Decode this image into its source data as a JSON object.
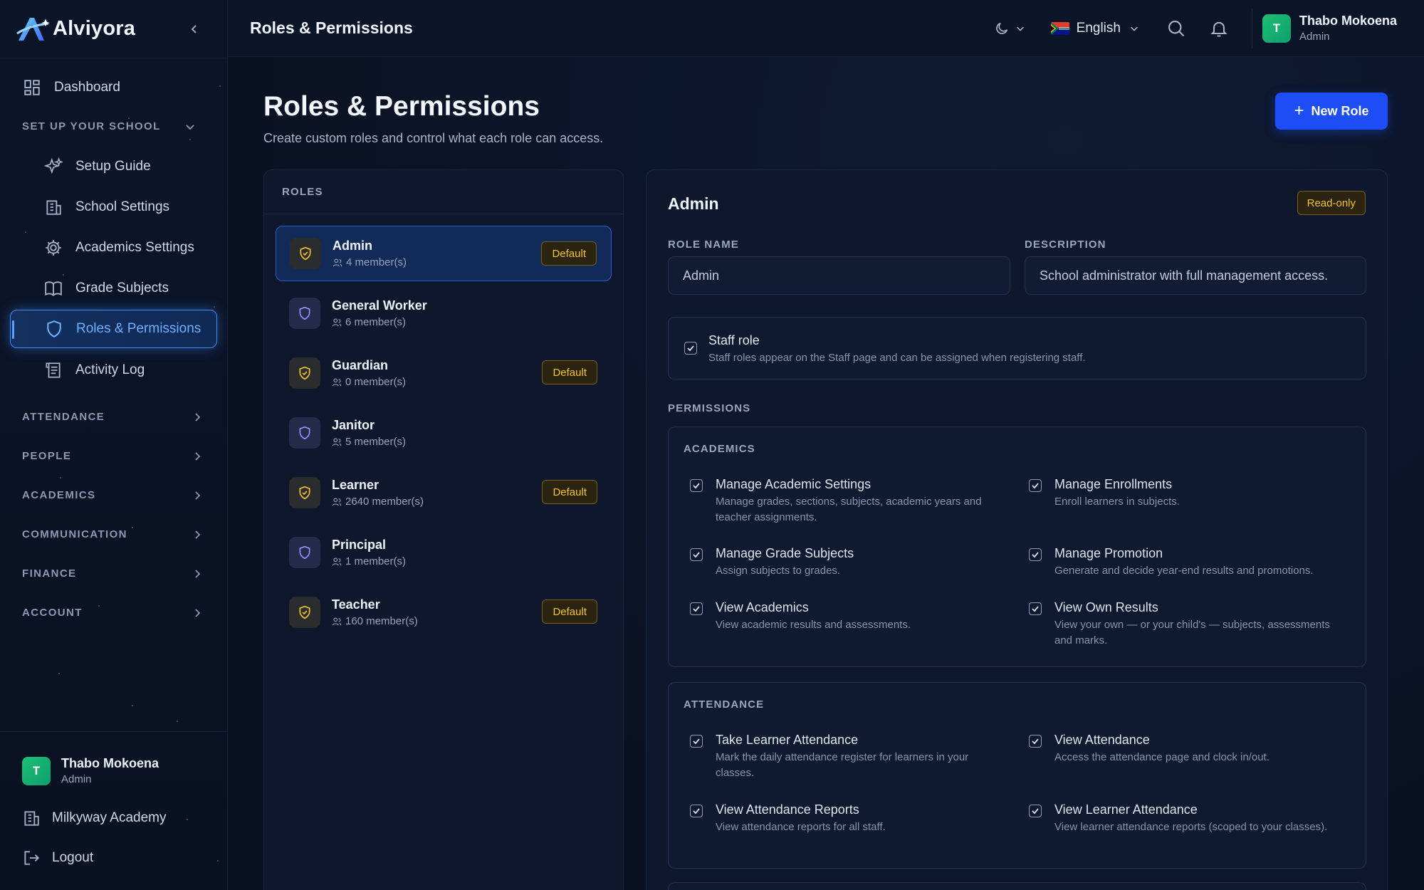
{
  "app": {
    "name": "Alviyora"
  },
  "sidebar": {
    "dashboard": "Dashboard",
    "setup_section": "SET UP YOUR SCHOOL",
    "setup_items": [
      {
        "label": "Setup Guide",
        "icon": "sparkles-icon"
      },
      {
        "label": "School Settings",
        "icon": "building-icon"
      },
      {
        "label": "Academics Settings",
        "icon": "gear-icon"
      },
      {
        "label": "Grade Subjects",
        "icon": "book-icon"
      },
      {
        "label": "Roles & Permissions",
        "icon": "shield-icon",
        "active": true
      },
      {
        "label": "Activity Log",
        "icon": "log-icon"
      }
    ],
    "sections": [
      "ATTENDANCE",
      "PEOPLE",
      "ACADEMICS",
      "COMMUNICATION",
      "FINANCE",
      "ACCOUNT"
    ],
    "user": {
      "initial": "T",
      "name": "Thabo Mokoena",
      "role": "Admin"
    },
    "school": "Milkyway Academy",
    "logout": "Logout"
  },
  "topbar": {
    "title": "Roles & Permissions",
    "language": "English",
    "user": {
      "initial": "T",
      "name": "Thabo Mokoena",
      "role": "Admin"
    }
  },
  "page": {
    "title": "Roles & Permissions",
    "subtitle": "Create custom roles and control what each role can access.",
    "new_role": "New Role"
  },
  "roles": {
    "header": "ROLES",
    "items": [
      {
        "name": "Admin",
        "count": "4 member(s)",
        "default": true,
        "badge": "Default",
        "selected": true
      },
      {
        "name": "General Worker",
        "count": "6 member(s)",
        "default": false
      },
      {
        "name": "Guardian",
        "count": "0 member(s)",
        "default": true,
        "badge": "Default"
      },
      {
        "name": "Janitor",
        "count": "5 member(s)",
        "default": false
      },
      {
        "name": "Learner",
        "count": "2640 member(s)",
        "default": true,
        "badge": "Default"
      },
      {
        "name": "Principal",
        "count": "1 member(s)",
        "default": false
      },
      {
        "name": "Teacher",
        "count": "160 member(s)",
        "default": true,
        "badge": "Default"
      }
    ]
  },
  "detail": {
    "title": "Admin",
    "readonly": "Read-only",
    "role_name_label": "ROLE NAME",
    "role_name_value": "Admin",
    "description_label": "DESCRIPTION",
    "description_value": "School administrator with full management access.",
    "staff_role_title": "Staff role",
    "staff_role_desc": "Staff roles appear on the Staff page and can be assigned when registering staff.",
    "permissions_label": "PERMISSIONS",
    "groups": [
      {
        "title": "ACADEMICS",
        "perms": [
          {
            "name": "Manage Academic Settings",
            "desc": "Manage grades, sections, subjects, academic years and teacher assignments."
          },
          {
            "name": "Manage Enrollments",
            "desc": "Enroll learners in subjects."
          },
          {
            "name": "Manage Grade Subjects",
            "desc": "Assign subjects to grades."
          },
          {
            "name": "Manage Promotion",
            "desc": "Generate and decide year-end results and promotions."
          },
          {
            "name": "View Academics",
            "desc": "View academic results and assessments."
          },
          {
            "name": "View Own Results",
            "desc": "View your own — or your child's — subjects, assessments and marks."
          }
        ]
      },
      {
        "title": "ATTENDANCE",
        "perms": [
          {
            "name": "Take Learner Attendance",
            "desc": "Mark the daily attendance register for learners in your classes."
          },
          {
            "name": "View Attendance",
            "desc": "Access the attendance page and clock in/out."
          },
          {
            "name": "View Attendance Reports",
            "desc": "View attendance reports for all staff."
          },
          {
            "name": "View Learner Attendance",
            "desc": "View learner attendance reports (scoped to your classes)."
          }
        ]
      }
    ]
  }
}
